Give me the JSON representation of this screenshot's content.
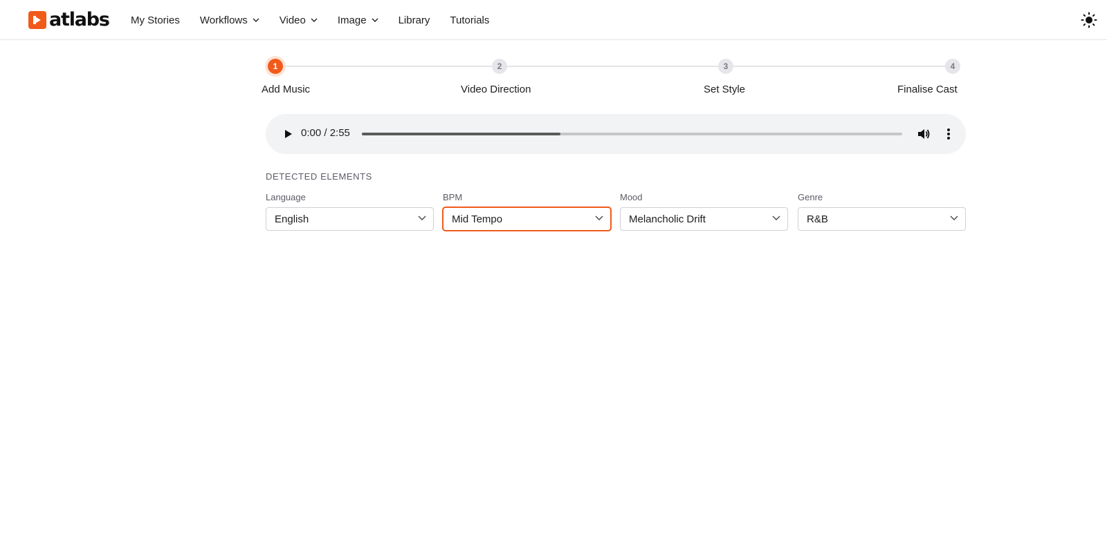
{
  "brand": {
    "name": "atlabs",
    "accent": "#f05a1a"
  },
  "nav": [
    {
      "label": "My Stories",
      "dropdown": false
    },
    {
      "label": "Workflows",
      "dropdown": true
    },
    {
      "label": "Video",
      "dropdown": true
    },
    {
      "label": "Image",
      "dropdown": true
    },
    {
      "label": "Library",
      "dropdown": false
    },
    {
      "label": "Tutorials",
      "dropdown": false
    }
  ],
  "theme_toggle_icon": "sun-icon",
  "stepper": {
    "active_step": 1,
    "steps": [
      {
        "number": "1",
        "label": "Add Music"
      },
      {
        "number": "2",
        "label": "Video Direction"
      },
      {
        "number": "3",
        "label": "Set Style"
      },
      {
        "number": "4",
        "label": "Finalise Cast"
      }
    ]
  },
  "player": {
    "time_display": "0:00 / 2:55",
    "progress_fraction": 0.367,
    "icons": [
      "play-icon",
      "volume-icon",
      "more-vertical-icon"
    ]
  },
  "detected": {
    "title": "DETECTED ELEMENTS",
    "fields": [
      {
        "label": "Language",
        "value": "English",
        "focused": false
      },
      {
        "label": "BPM",
        "value": "Mid Tempo",
        "focused": true
      },
      {
        "label": "Mood",
        "value": "Melancholic Drift",
        "focused": false
      },
      {
        "label": "Genre",
        "value": "R&B",
        "focused": false
      }
    ]
  }
}
